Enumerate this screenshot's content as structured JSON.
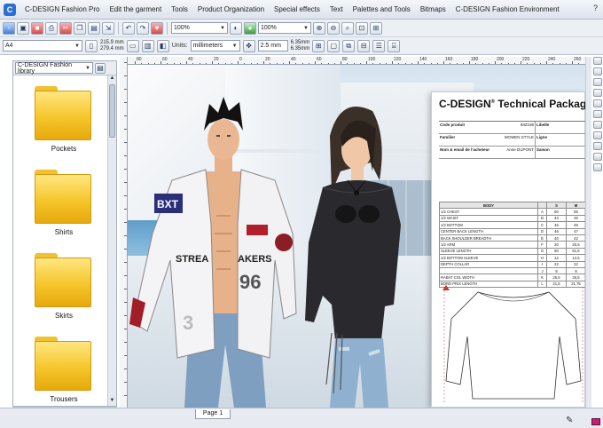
{
  "menubar": {
    "items": [
      "C-DESIGN Fashion Pro",
      "Edit the garment",
      "Tools",
      "Product Organization",
      "Special effects",
      "Text",
      "Palettes and Tools",
      "Bitmaps",
      "C-DESIGN Fashion Environment"
    ],
    "help": "?"
  },
  "toolbar": {
    "zoom_value": "100%",
    "zoom2_value": "100%",
    "page_size": "A4",
    "width": "215.9 mm",
    "height": "279.4 mm",
    "units_label": "Units:",
    "units_value": "millimeters",
    "nudge_value": "2.5 mm",
    "dup_x": "6.35mm",
    "dup_y": "6.35mm"
  },
  "left_panel": {
    "dropdown": "C-DESIGN Fashion library",
    "folders": [
      "Pockets",
      "Shirts",
      "Skirts",
      "Trousers"
    ]
  },
  "ruler": {
    "labels": [
      "80",
      "60",
      "40",
      "20",
      "0",
      "20",
      "40",
      "60",
      "80",
      "100",
      "120",
      "140",
      "160",
      "180",
      "200",
      "220",
      "240",
      "260"
    ]
  },
  "sheet": {
    "title": "C-DESIGN",
    "title_reg": "®",
    "title_rest": " Technical Package",
    "info": [
      {
        "k": "Code produit",
        "v": "IMZ198",
        "k2": "Libelle"
      },
      {
        "k": "Familier",
        "v": "WOMEN STYLE",
        "k2": "Ligne"
      },
      {
        "k": "Nom & email de l'acheteur",
        "v": "Anne DUPONT",
        "k2": "Saison"
      }
    ],
    "size_headers": [
      "BODY",
      "",
      "S",
      "M"
    ],
    "rows": [
      {
        "label": "1/2 CHEST",
        "code": "A",
        "s": "50",
        "m": "55"
      },
      {
        "label": "1/2 WAIST",
        "code": "B",
        "s": "44",
        "m": "46"
      },
      {
        "label": "1/2 BOTTOM",
        "code": "C",
        "s": "46",
        "m": "48"
      },
      {
        "label": "CENTER BACK LENGTH",
        "code": "D",
        "s": "46",
        "m": "47"
      },
      {
        "label": "BACK SHOULDER BREADTH",
        "code": "E",
        "s": "40",
        "m": "42"
      },
      {
        "label": "1/2 ARM",
        "code": "F",
        "s": "20",
        "m": "20,5"
      },
      {
        "label": "SLEEVE LENGTH",
        "code": "G",
        "s": "60",
        "m": "61,5"
      },
      {
        "label": "1/2 BOTTOM SLEEVE",
        "code": "H",
        "s": "12",
        "m": "12,5"
      },
      {
        "label": "DEPTH COLLAR",
        "code": "I",
        "s": "22",
        "m": "22"
      },
      {
        "label": "",
        "code": "J",
        "s": "8",
        "m": "8"
      },
      {
        "label": "RABAT COL WIDTH",
        "code": "K",
        "s": "25,5",
        "m": "26,5"
      },
      {
        "label": "BORD PRIX LENGTH",
        "code": "L",
        "s": "21,5",
        "m": "21,75"
      }
    ]
  },
  "status": {
    "page_tab": "Page 1"
  }
}
